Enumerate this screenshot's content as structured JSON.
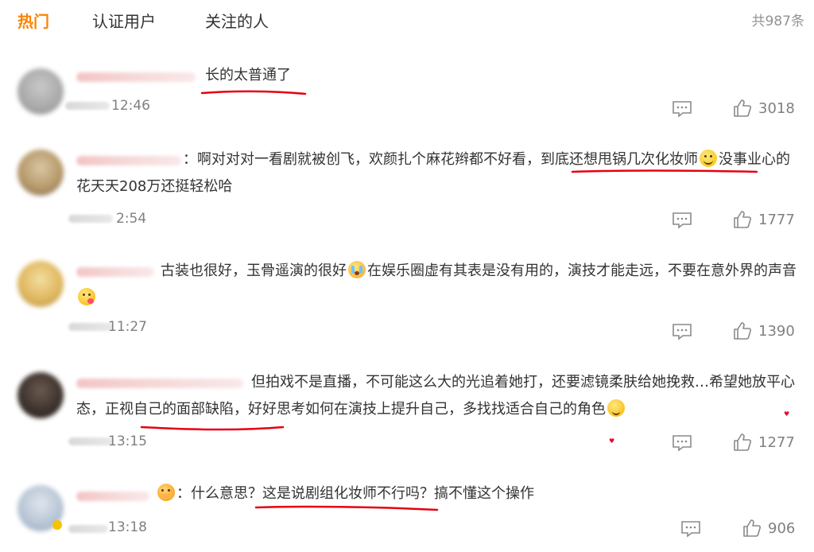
{
  "tabs": [
    {
      "label": "热门",
      "active": true
    },
    {
      "label": "认证用户",
      "active": false
    },
    {
      "label": "关注的人",
      "active": false
    }
  ],
  "total_count": "共987条",
  "colors": {
    "accent": "#ff8200",
    "underline": "#e60012",
    "meta": "#808080"
  },
  "comments": [
    {
      "avatar_icon": "user-avatar",
      "text_parts": [
        "长的太普通了"
      ],
      "time": "12:46",
      "likes": "3018"
    },
    {
      "avatar_icon": "user-avatar",
      "text_parts": [
        "：啊对对对一看剧就被创飞，欢颜扎个麻花辫都不好看，",
        "到底还想甩锅几次化妆师",
        "没事业心的花天天208万还挺轻松哈"
      ],
      "emoji": "smile-emoji",
      "time": "2:54",
      "likes": "1777"
    },
    {
      "avatar_icon": "user-avatar",
      "text_parts": [
        "古装也很好，玉骨遥演的很好",
        "在娱乐圈虚有其表是没有用的，演技才能走远，不要在意外界的声音"
      ],
      "emoji": "cry-emoji",
      "emoji2": "kiss-emoji",
      "time": "11:27",
      "likes": "1390"
    },
    {
      "avatar_icon": "user-avatar",
      "text_parts": [
        "但拍戏不是直播，不可能这么大的光追着她打，还要滤镜柔肤给她挽救…希望她放平心态，",
        "正视自己的面部缺陷",
        "，好好思考如何在演技上提升自己，多找找适合自己的角色"
      ],
      "emoji": "heart-eyes-emoji",
      "time": "13:15",
      "likes": "1277"
    },
    {
      "avatar_icon": "user-avatar",
      "text_parts": [
        "：什么意思？",
        "这是说剧组化妆师不行吗",
        "？搞不懂这个操作"
      ],
      "emoji": "hug-emoji",
      "time": "13:18",
      "likes": "906"
    }
  ]
}
